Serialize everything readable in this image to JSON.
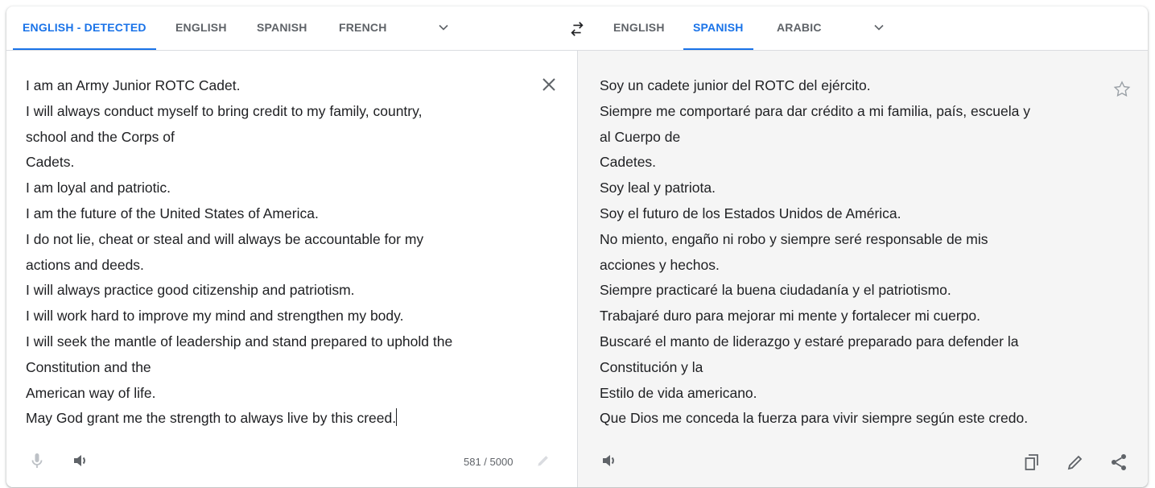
{
  "source_tabs": [
    {
      "label": "ENGLISH - DETECTED",
      "active": true
    },
    {
      "label": "ENGLISH",
      "active": false
    },
    {
      "label": "SPANISH",
      "active": false
    },
    {
      "label": "FRENCH",
      "active": false
    }
  ],
  "target_tabs": [
    {
      "label": "ENGLISH",
      "active": false
    },
    {
      "label": "SPANISH",
      "active": true
    },
    {
      "label": "ARABIC",
      "active": false
    }
  ],
  "source": {
    "text": "I am an Army Junior ROTC Cadet.\nI will always conduct myself to bring credit to my family, country,\nschool and the Corps of\nCadets.\nI am loyal and patriotic.\nI am the future of the United States of America.\nI do not lie, cheat or steal and will always be accountable for my\nactions and deeds.\nI will always practice good citizenship and patriotism.\nI will work hard to improve my mind and strengthen my body.\nI will seek the mantle of leadership and stand prepared to uphold the\nConstitution and the\nAmerican way of life.\nMay God grant me the strength to always live by this creed.",
    "char_count": "581 / 5000"
  },
  "translation": {
    "text": "Soy un cadete junior del ROTC del ejército.\nSiempre me comportaré para dar crédito a mi familia, país, escuela y\nal Cuerpo de\nCadetes.\nSoy leal y patriota.\nSoy el futuro de los Estados Unidos de América.\nNo miento, engaño ni robo y siempre seré responsable de mis\nacciones y hechos.\nSiempre practicaré la buena ciudadanía y el patriotismo.\nTrabajaré duro para mejorar mi mente y fortalecer mi cuerpo.\nBuscaré el manto de liderazgo y estaré preparado para defender la\nConstitución y la\nEstilo de vida americano.\nQue Dios me conceda la fuerza para vivir siempre según este credo."
  },
  "icons": {
    "more_source": "chevron-down-icon",
    "swap": "swap-languages-icon",
    "more_target": "chevron-down-icon",
    "clear": "close-icon",
    "star": "star-outline-icon",
    "mic": "microphone-icon",
    "listen": "speaker-icon",
    "edit": "pencil-icon",
    "copy": "copy-icon",
    "share": "share-icon"
  },
  "colors": {
    "accent": "#1a73e8",
    "tab_text": "#5f6368",
    "text": "#202124",
    "result_bg": "#f5f5f5"
  }
}
